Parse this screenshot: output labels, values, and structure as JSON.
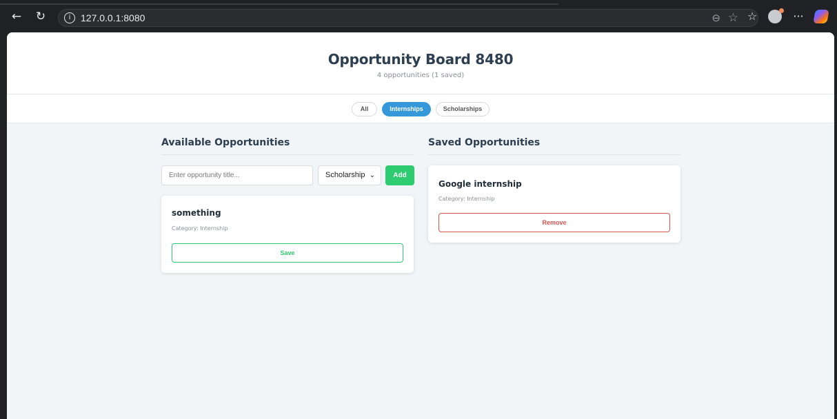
{
  "browser": {
    "url": "127.0.0.1:8080"
  },
  "header": {
    "title": "Opportunity Board 8480",
    "subtitle": "4 opportunities (1 saved)"
  },
  "filters": [
    {
      "label": "All",
      "active": false
    },
    {
      "label": "Internships",
      "active": true
    },
    {
      "label": "Scholarships",
      "active": false
    }
  ],
  "available": {
    "heading": "Available Opportunities",
    "input_placeholder": "Enter opportunity title...",
    "input_value": "",
    "select_value": "Scholarship",
    "add_label": "Add",
    "items": [
      {
        "title": "something",
        "category": "Category: Internship",
        "action": "Save"
      }
    ]
  },
  "saved": {
    "heading": "Saved Opportunities",
    "items": [
      {
        "title": "Google internship",
        "category": "Category: Internship",
        "action": "Remove"
      }
    ]
  },
  "colors": {
    "primary": "#3498db",
    "success": "#2ecc71",
    "danger": "#d9534f",
    "heading": "#2c3e50",
    "background": "#f1f5f8"
  }
}
